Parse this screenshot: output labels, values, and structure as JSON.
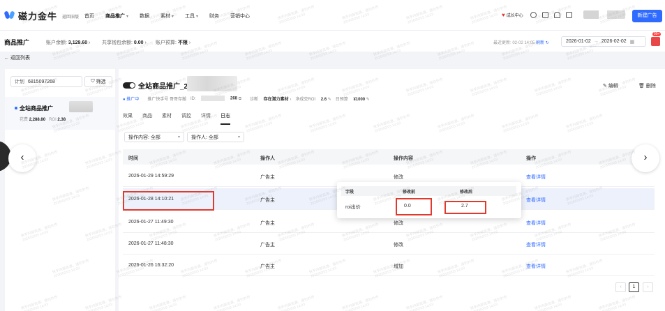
{
  "brand": {
    "name": "磁力金牛",
    "sub": "返回旧版"
  },
  "nav": [
    {
      "label": "首页",
      "caret": ""
    },
    {
      "label": "商品推广",
      "caret": "▾",
      "active": true
    },
    {
      "label": "数据",
      "caret": ""
    },
    {
      "label": "素材",
      "caret": "▾"
    },
    {
      "label": "工具",
      "caret": "▾"
    },
    {
      "label": "财务",
      "caret": ""
    },
    {
      "label": "营销中心",
      "caret": ""
    }
  ],
  "header": {
    "growth_center": "成长中心",
    "new_ad_button": "新建广告"
  },
  "subheader": {
    "title": "商品推广",
    "balance_label": "账户余额:",
    "balance_value": "3,129.60",
    "wallet_label": "共享钱包余额:",
    "wallet_value": "0.00",
    "budget_label": "账户预算:",
    "budget_value": "不限",
    "updated": "最近更新: 02-02 14:05",
    "refresh": "刷新",
    "date_start": "2026-01-02",
    "date_sep": "→",
    "date_end": "2026-02-02",
    "gift_badge": "99+"
  },
  "back_link": "← 返回列表",
  "sidebar": {
    "plan_label": "计划",
    "plan_value": "6815097268",
    "filter_button": "筛选",
    "card": {
      "name": "全站商品推广",
      "spend_label": "花费",
      "spend_value": "2,288.80",
      "roi_label": "ROI",
      "roi_value": "2.38"
    }
  },
  "plan": {
    "title": "全站商品推广_2",
    "edit": "编辑",
    "delete": "删除",
    "status": "推广中",
    "account": "推广快手号 哥哥存搬",
    "id_label": "ID:",
    "id_suffix": "268",
    "diagnosis_label": "诊断",
    "diagnosis_value": "存在潜力素材",
    "roi_label": "净成交ROI",
    "roi_value": "2.6",
    "budget_label": "日预算",
    "budget_value": "¥1000"
  },
  "tabs": [
    "效果",
    "商品",
    "素材",
    "调控",
    "详情",
    "日志"
  ],
  "filters": {
    "content": "操作内容: 全部",
    "operator": "操作人: 全部"
  },
  "table": {
    "headers": [
      "时间",
      "操作人",
      "操作内容",
      "操作"
    ],
    "rows": [
      {
        "time": "2026-01-29 14:59:29",
        "operator": "广告主",
        "content": "修改",
        "action": "查看详情"
      },
      {
        "time": "2026-01-28 14:10:21",
        "operator": "广告主",
        "content": "",
        "action": "查看详情"
      },
      {
        "time": "2026-01-27 11:49:30",
        "operator": "广告主",
        "content": "修改",
        "action": "查看详情"
      },
      {
        "time": "2026-01-27 11:48:30",
        "operator": "广告主",
        "content": "修改",
        "action": "查看详情"
      },
      {
        "time": "2026-01-26 16:32:20",
        "operator": "广告主",
        "content": "增加",
        "action": "查看详情"
      }
    ]
  },
  "popover": {
    "headers": [
      "字段",
      "修改前",
      "修改后"
    ],
    "field": "roi出价",
    "before": "0.0",
    "after": "2.7"
  },
  "pagination": {
    "prev": "‹",
    "page": "1",
    "next": "›"
  },
  "carousel": {
    "prev": "‹",
    "next": "›"
  },
  "watermark": {
    "line1": "快手内部资源、请勿外传",
    "line2": "2026/02/03 14:03"
  },
  "colors": {
    "accent": "#2f6bff",
    "annotation": "#e03a2f",
    "highlight_row": "#edf1fb"
  }
}
